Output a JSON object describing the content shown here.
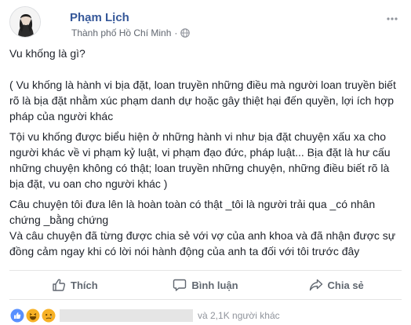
{
  "post": {
    "author": "Phạm Lịch",
    "location": "Thành phố Hồ Chí Minh",
    "separator": "·",
    "paragraphs": [
      "Vu khống là gì?",
      "( Vu khống là hành vi bịa đặt, loan truyền những điều mà người loan truyền biết rõ là bịa đặt nhằm xúc phạm danh dự hoặc gây thiệt hại đến quyền, lợi ích hợp pháp của người khác",
      "Tội vu khống được biểu hiện ở những hành vi như bịa đặt chuyện xấu xa cho người khác về vi phạm kỷ luật, vi phạm đạo đức, pháp luật... Bịa đặt là hư cấu những chuyện không có thật; loan truyền những chuyện, những điều biết rõ là bịa đặt, vu oan cho người khác )",
      "Câu chuyện tôi đưa lên là hoàn toàn có thật _tôi là người trải qua _có nhân chứng _bằng chứng",
      "Và câu chuyện đã từng được chia sẻ với vợ của anh khoa và đã nhận được sự đồng cảm ngay khi có lời nói hành động của anh ta đối với tôi trước đây"
    ]
  },
  "actions": {
    "like": "Thích",
    "comment": "Bình luận",
    "share": "Chia sẻ"
  },
  "reactions": {
    "icons": [
      "like-reaction",
      "haha-reaction",
      "sad-reaction"
    ],
    "others_text": "và 2,1K người khác"
  },
  "colors": {
    "author": "#365899",
    "meta": "#616770",
    "text": "#1d2129",
    "action": "#606770",
    "like_blue": "#5890ff",
    "reaction_yellow": "#f7b125"
  }
}
